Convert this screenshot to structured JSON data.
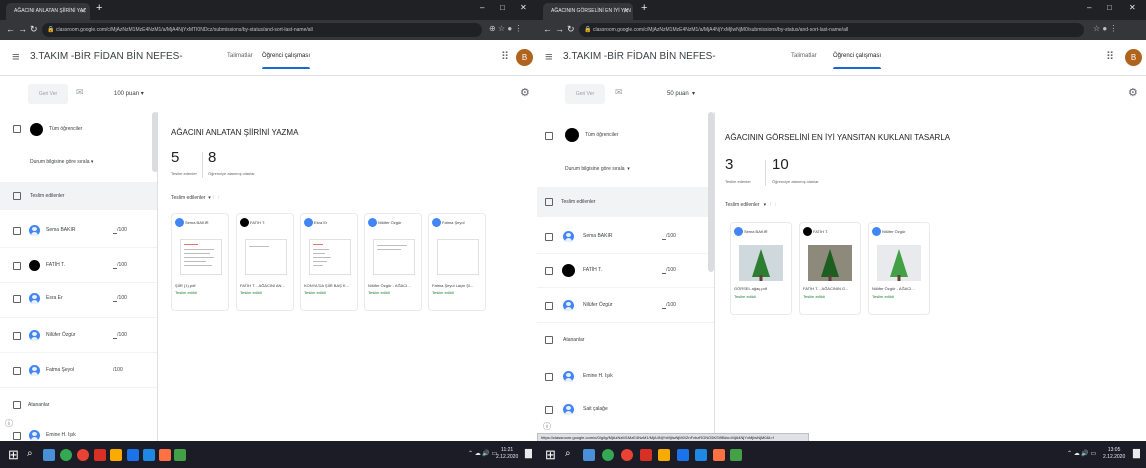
{
  "left": {
    "tab_title": "AĞACINI ANLATAN ŞİİRİNİ YAZ",
    "url": "classroom.google.com/c/MjAzNzM1MzE4NzM1/a/MjA4NjYxMTI0NDcz/submissions/by-status/and-sort-last-name/all",
    "class_title": "3.TAKIM -BİR FİDAN BİN NEFES-",
    "tab_instructions": "Talimatlar",
    "tab_student_work": "Öğrenci çalışması",
    "avatar_letter": "B",
    "return_label": "Geri Ver",
    "points": "100 puan",
    "all_students": "Tüm öğrenciler",
    "sort_label": "Durum bilgisine göre sırala",
    "section_submitted": "Teslim edilenler",
    "section_assigned": "Atananlar",
    "students": [
      {
        "name": "Sema BAKIR",
        "grade": "/100"
      },
      {
        "name": "FATİH T.",
        "grade": "/100"
      },
      {
        "name": "Esra Er",
        "grade": "/100"
      },
      {
        "name": "Nilüfer Özgür",
        "grade": "/100"
      },
      {
        "name": "Fatma Şeyol",
        "grade": "/100"
      }
    ],
    "assignment_title": "AĞACINI ANLATAN ŞİİRİNİ YAZMA",
    "submitted_count": "5",
    "submitted_label": "Teslim edenler",
    "assigned_count": "8",
    "assigned_label": "Öğrenciye atanmış olanlar",
    "filter_label": "Teslim edilenler",
    "cards": [
      {
        "name": "Sema BAKIR",
        "file": "ŞİİR (1).pdf",
        "status": "Teslim edildi"
      },
      {
        "name": "FATİH T.",
        "file": "FATİH T. - AĞACINI AN...",
        "status": "Teslim edildi"
      },
      {
        "name": "Esra Er",
        "file": "KONYA'DA ŞİİR BAŞ K...",
        "status": "Teslim edildi"
      },
      {
        "name": "Nilüfer Özgür",
        "file": "Nilüfer Özgür - AĞACI...",
        "status": "Teslim edildi"
      },
      {
        "name": "Fatma Şeyol",
        "file": "Fatma Şeyol Laçin Şi...",
        "status": "Teslim edildi"
      }
    ],
    "partial_student": "Emine H. Işık",
    "clock_time": "11:21",
    "clock_date": "2.12.2020"
  },
  "right": {
    "tab_title": "AĞACININ GÖRSELİNİ EN İYİ YAN",
    "url": "classroom.google.com/c/MjAzNzM1MzE4NzM1/a/MjA4NjYxMjIwNjM0/submissions/by-status/and-sort-last-name/all",
    "class_title": "3.TAKIM -BİR FİDAN BİN NEFES-",
    "tab_instructions": "Talimatlar",
    "tab_student_work": "Öğrenci çalışması",
    "avatar_letter": "B",
    "return_label": "Geri Ver",
    "points": "50 puan",
    "all_students": "Tüm öğrenciler",
    "sort_label": "Durum bilgisine göre sırala",
    "section_submitted": "Teslim edilenler",
    "section_assigned": "Atananlar",
    "students": [
      {
        "name": "Sema BAKIR",
        "grade": "/100"
      },
      {
        "name": "FATİH T.",
        "grade": "/100"
      },
      {
        "name": "Nilüfer Özgür",
        "grade": "/100"
      }
    ],
    "assigned_students": [
      "Emine H. Işık",
      "Sait çalağe"
    ],
    "assignment_title": "AĞACININ GÖRSELİNİ EN İYİ YANSITAN KUKLANI TASARLA",
    "submitted_count": "3",
    "submitted_label": "Teslim edenler",
    "assigned_count": "10",
    "assigned_label": "Öğrenciye atanmış olanlar",
    "filter_label": "Teslim edilenler",
    "cards": [
      {
        "name": "Sema BAKIR",
        "file": "GÖRSEL ağaç.pdf",
        "status": "Teslim edildi"
      },
      {
        "name": "FATİH T.",
        "file": "FATİH T. - AĞACININ G...",
        "status": "Teslim edildi"
      },
      {
        "name": "Nilüfer Özgür",
        "file": "Nilüfer Özgür - AĞACI...",
        "status": "Teslim edildi"
      }
    ],
    "status_url": "https://classroom.google.com/u/0/g/tg/MjAzNzM1MzE4NzM1/MjA4NjYxMjIwNjM0/ZnFxbzRGNG5KSl9B#u=MjA4NjYxMjIwNjM0&t=f",
    "clock_time": "13:05",
    "clock_date": "2.12.2020"
  }
}
